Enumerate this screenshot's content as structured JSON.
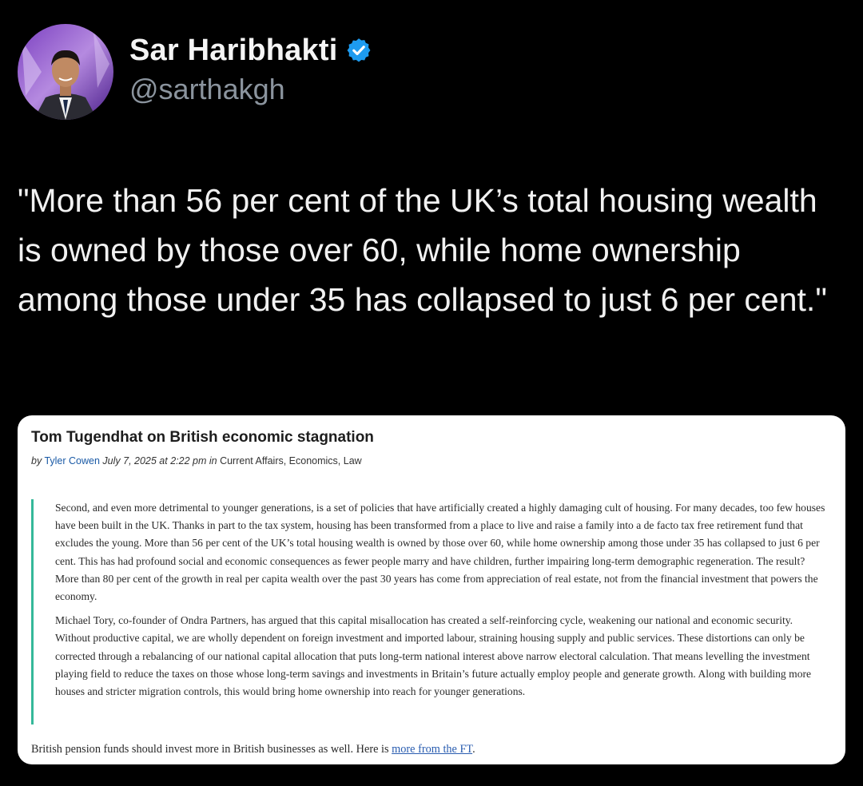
{
  "tweet": {
    "author": {
      "display_name": "Sar Haribhakti",
      "handle": "@sarthakgh",
      "verified": true,
      "verified_color": "#1d9bf0"
    },
    "text": "\"More than 56 per cent of the UK’s total housing wealth is owned by those over 60, while home ownership among those under 35 has collapsed to just 6 per cent.\""
  },
  "card": {
    "title": "Tom Tugendhat on British economic stagnation",
    "byline": {
      "by": "by",
      "author": "Tyler Cowen",
      "date": "July 7, 2025 at 2:22 pm in",
      "categories": "Current Affairs, Economics, Law"
    },
    "quote_paragraphs": [
      "Second, and even more detrimental to younger generations, is a set of policies that have artificially created a highly damaging cult of housing. For many decades, too few houses have been built in the UK. Thanks in part to the tax system, housing has been transformed from a place to live and raise a family into a de facto tax free retirement fund that excludes the young. More than 56 per cent of the UK’s total housing wealth is owned by those over 60, while home ownership among those under 35 has collapsed to just 6 per cent. This has had profound social and economic consequences as fewer people marry and have children, further impairing long-term demographic regeneration. The result? More than 80 per cent of the growth in real per capita wealth over the past 30 years has come from appreciation of real estate, not from the financial investment that powers the economy.",
      "Michael Tory, co-founder of Ondra Partners, has argued that this capital misallocation has created a self-reinforcing cycle, weakening our national and economic security. Without productive capital, we are wholly dependent on foreign investment and imported labour, straining housing supply and public services. These distortions can only be corrected through a rebalancing of our national capital allocation that puts long-term national interest above narrow electoral calculation. That means levelling the investment playing field to reduce the taxes on those whose long-term savings and investments in Britain’s future actually employ people and generate growth. Along with building more houses and stricter migration controls, this would bring home ownership into reach for younger generations."
    ],
    "footer": {
      "text": "British pension funds should invest more in British businesses as well.  Here is ",
      "link_text": "more from the FT",
      "end": "."
    },
    "quote_bar_color": "#35b89a"
  }
}
